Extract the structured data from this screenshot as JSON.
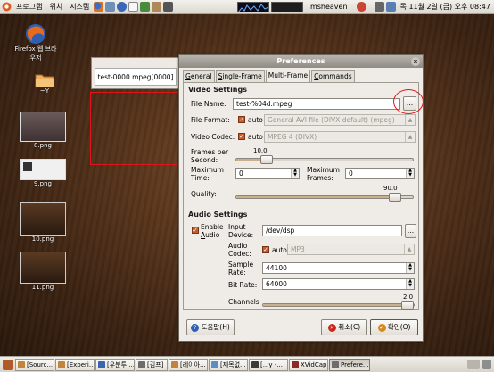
{
  "top_panel": {
    "menus": [
      "프로그램",
      "위치",
      "시스템"
    ],
    "user": "msheaven",
    "clock": "목 11월 2일 (금) 오후 08:47"
  },
  "desktop_icons": {
    "firefox": "Firefox 웹 브라우저",
    "folder": "~Y",
    "png1": "8.png",
    "png2": "9.png",
    "png3": "10.png",
    "png4": "11.png"
  },
  "side_window": {
    "tab_label": "test-0000.mpeg[0000]"
  },
  "dialog": {
    "title": "Preferences",
    "close": "x",
    "tabs": [
      {
        "pre": "",
        "ul": "G",
        "post": "eneral"
      },
      {
        "pre": "",
        "ul": "S",
        "post": "ingle-Frame"
      },
      {
        "pre": "M",
        "ul": "u",
        "post": "lti-Frame"
      },
      {
        "pre": "",
        "ul": "C",
        "post": "ommands"
      }
    ],
    "video_settings": "Video Settings",
    "file_name_label": "File Name:",
    "file_name_value": "test-%04d.mpeg",
    "browse_label": "...",
    "file_format_label": "File Format:",
    "auto_label": "auto",
    "file_format_value": "General AVI file (DIVX default) (mpeg)",
    "video_codec_label": "Video Codec:",
    "video_codec_value": "MPEG 4 (DIVX)",
    "fps_label": "Frames per Second:",
    "fps_value": "10.0",
    "fps_level": 0.17,
    "max_time_label": "Maximum Time:",
    "max_time_value": "0",
    "max_frames_label": "Maximum Frames:",
    "max_frames_value": "0",
    "quality_label": "Quality:",
    "quality_value": "90.0",
    "quality_level": 0.9,
    "audio_settings": "Audio Settings",
    "enable_audio_pre": "Enable",
    "enable_audio_ul": "A",
    "enable_audio_post": "udio",
    "input_device_label": "Input Device:",
    "input_device_value": "/dev/dsp",
    "audio_codec_label": "Audio Codec:",
    "audio_codec_value": "MP3",
    "sample_rate_label": "Sample Rate:",
    "sample_rate_value": "44100",
    "bit_rate_label": "Bit Rate:",
    "bit_rate_value": "64000",
    "channels_label": "Channels",
    "channels_value": "2.0",
    "channels_level": 1.0,
    "help_label": "도움말(H)",
    "cancel_label": "취소(C)",
    "ok_label": "확인(O)"
  },
  "taskbar": [
    {
      "label": "[Sourc...",
      "icon_color": "#c0843a"
    },
    {
      "label": "[Experi...",
      "icon_color": "#c0843a"
    },
    {
      "label": "[우분투 ...",
      "icon_color": "#3a63b0"
    },
    {
      "label": "[김프]",
      "icon_color": "#6d6d6d"
    },
    {
      "label": "[레이아...",
      "icon_color": "#c0843a"
    },
    {
      "label": "[제목없...",
      "icon_color": "#5d8dc7"
    },
    {
      "label": "[...y -...",
      "icon_color": "#3a3a3a"
    },
    {
      "label": "XVidCap",
      "icon_color": "#8b2a2a"
    },
    {
      "label": "Prefere...",
      "icon_color": "#6d6d6d"
    }
  ]
}
